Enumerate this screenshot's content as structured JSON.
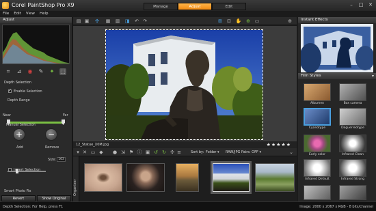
{
  "app": {
    "title": "Corel PaintShop Pro X9"
  },
  "mode_tabs": [
    {
      "label": "Manage",
      "active": false
    },
    {
      "label": "Adjust",
      "active": true
    },
    {
      "label": "Edit",
      "active": false
    }
  ],
  "window_controls": {
    "minimize": "–",
    "maximize": "□",
    "close": "✕"
  },
  "menu": {
    "items": [
      "File",
      "Edit",
      "View",
      "Help"
    ]
  },
  "adjust_panel": {
    "title": "Adjust",
    "depth_selection": {
      "heading": "Depth Selection",
      "enable_label": "Enable Selection",
      "enable_checked": true,
      "depth_range_label": "Depth Range",
      "near_label": "Near",
      "far_label": "Far",
      "manual_heading": "Manual Selection",
      "add_label": "Add",
      "remove_label": "Remove",
      "size_label": "Size:",
      "size_value": "163",
      "invert_label": "Invert Selection",
      "invert_checked": false
    },
    "smart_photo_fix": "Smart Photo Fix",
    "buttons": {
      "revert": "Revert",
      "show_original": "Show Original"
    }
  },
  "image": {
    "filename": "12_Statue_X0M.jpg",
    "rating_stars": "★★★★★"
  },
  "organizer": {
    "side_label": "Organizer",
    "sort_label": "Sort by:",
    "sort_value": "Folder ▾",
    "raw_pairs": "RAW/JPG Pairs: OFF ▾"
  },
  "instant_effects": {
    "title": "Instant Effects",
    "category": "Film Styles",
    "items": [
      {
        "label": "Albumen",
        "swatch": "#b8864e"
      },
      {
        "label": "Box camera",
        "swatch": "#8c8c8c"
      },
      {
        "label": "Cyanotype",
        "swatch": "#3a5f9a"
      },
      {
        "label": "Daguerreotype",
        "swatch": "#a8a8a8"
      },
      {
        "label": "Early color",
        "swatch": "#c86b9e"
      },
      {
        "label": "Infrared Clean",
        "swatch": "#9a9a9a"
      },
      {
        "label": "Infrared Default",
        "swatch": "#d8d8d8"
      },
      {
        "label": "Infrared Strong",
        "swatch": "#b0b0b0"
      }
    ]
  },
  "status": {
    "left": "Depth Selection: For Help, press F1",
    "right": "Image: 2000 x 2067 x RGB - 8 bits/channel"
  }
}
